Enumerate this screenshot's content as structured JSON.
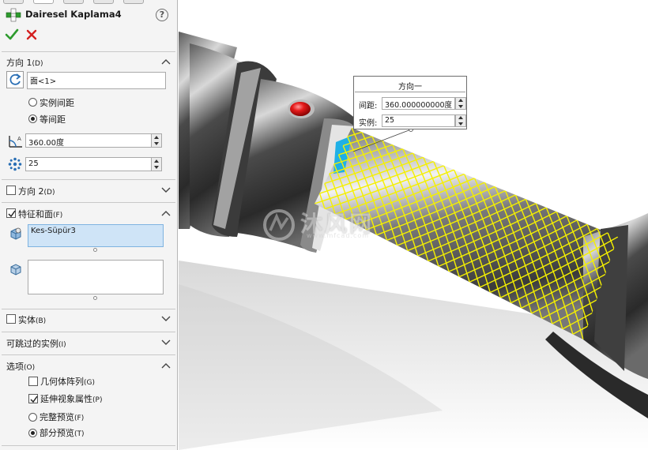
{
  "feature": {
    "title": "Dairesel Kaplama4",
    "help_symbol": "?"
  },
  "direction1": {
    "title": "方向 1",
    "shortcut": "(D)",
    "reference_value": "面<1>",
    "radio_instance_spacing": "实例间距",
    "radio_equal_spacing": "等间距",
    "selected_radio": "等间距",
    "angle_value": "360.00度",
    "count_value": "25"
  },
  "direction2": {
    "title": "方向 2",
    "shortcut": "(D)",
    "checked": false
  },
  "features_faces": {
    "title": "特征和面",
    "shortcut": "(F)",
    "checked": true,
    "features_list_item": "Kes-Süpür3"
  },
  "bodies": {
    "title": "实体",
    "shortcut": "(B)",
    "checked": false
  },
  "skip_instances": {
    "title": "可跳过的实例",
    "shortcut": "(I)"
  },
  "options": {
    "title": "选项",
    "shortcut": "(O)",
    "geometry_pattern": {
      "label": "几何体阵列",
      "shortcut": "(G)",
      "checked": false
    },
    "propagate_visual": {
      "label": "延伸视象属性",
      "shortcut": "(P)",
      "checked": true
    },
    "full_preview": {
      "label": "完整预览",
      "shortcut": "(F)"
    },
    "partial_preview": {
      "label": "部分预览",
      "shortcut": "(T)"
    },
    "selected_preview": "部分预览"
  },
  "callout": {
    "title": "方向一",
    "spacing_label": "间距:",
    "spacing_value": "360.000000000度",
    "instances_label": "实例:",
    "instances_value": "25"
  },
  "watermark": {
    "text": "沐风网",
    "url": "www.mfcad.com"
  },
  "colors": {
    "pattern_preview": "#f5f000",
    "accent_ok": "#2e9b2e",
    "accent_cancel": "#d42020",
    "selection_fill": "#cfe4f7"
  }
}
